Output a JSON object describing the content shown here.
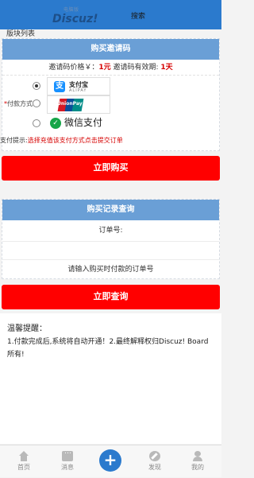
{
  "header": {
    "logo_small": "电脑版",
    "logo_main": "Discuz!",
    "search": "搜索"
  },
  "breadcrumb": "版块列表",
  "buy": {
    "title": "购买邀请码",
    "price_prefix": "邀请码价格￥：",
    "price": "1元",
    "valid_prefix": "邀请码有效期:",
    "valid": "1天",
    "pay_label_req": "*",
    "pay_label": "付款方式",
    "methods": [
      {
        "name": "支付宝",
        "sub": "ALIPAY",
        "selected": true
      },
      {
        "name": "UnionPay",
        "selected": false
      },
      {
        "name": "微信支付",
        "selected": false
      }
    ],
    "tip_prefix": "支付提示:",
    "tip_red": "选择充值该支付方式点击提交订单",
    "submit": "立即购买"
  },
  "query": {
    "title": "购买记录查询",
    "order_label": "订单号:",
    "order_value": "",
    "hint": "请输入购买时付款的订单号",
    "submit": "立即查询"
  },
  "notice": {
    "title": "温馨提醒：",
    "body": "1.付款完成后,系统将自动开通！2.最终解释权归Discuz! Board所有!"
  },
  "tabs": [
    {
      "label": "首页"
    },
    {
      "label": "消息"
    },
    {
      "label": "+"
    },
    {
      "label": "发现"
    },
    {
      "label": "我的"
    }
  ]
}
